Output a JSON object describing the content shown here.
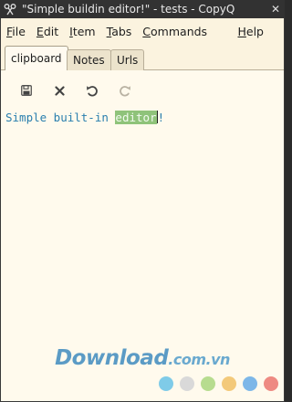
{
  "window": {
    "title": "\"Simple buildin editor!\" - tests - CopyQ",
    "close_glyph": "✕"
  },
  "menu": [
    {
      "label": "File",
      "mnemonic": "F",
      "rest": "ile"
    },
    {
      "label": "Edit",
      "mnemonic": "E",
      "rest": "dit"
    },
    {
      "label": "Item",
      "mnemonic": "I",
      "rest": "tem"
    },
    {
      "label": "Tabs",
      "mnemonic": "T",
      "rest": "abs"
    },
    {
      "label": "Commands",
      "mnemonic": "C",
      "rest": "ommands"
    },
    {
      "label": "Help",
      "mnemonic": "H",
      "rest": "elp"
    }
  ],
  "tabs": [
    {
      "label": "clipboard",
      "active": true
    },
    {
      "label": "Notes",
      "active": false
    },
    {
      "label": "Urls",
      "active": false
    }
  ],
  "toolbar": {
    "save_icon": "save-icon",
    "cancel_icon": "close-icon",
    "undo_icon": "undo-icon",
    "redo_icon": "redo-icon"
  },
  "editor": {
    "text_before": "Simple built-in ",
    "selected_text": "editor",
    "text_after": "!"
  },
  "watermark": {
    "main": "Download",
    "suffix": ".com.vn",
    "dot_colors": [
      "#7fcbe8",
      "#d9d9d9",
      "#b7dc8f",
      "#f3c97a",
      "#7db7e8",
      "#ee8a82"
    ]
  },
  "colors": {
    "background": "#fffaed",
    "text": "#2a7fae",
    "selection": "#8fc37a"
  }
}
